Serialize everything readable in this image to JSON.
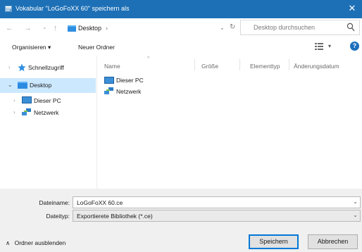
{
  "window": {
    "title": "Vokabular \"LoGoFoXX 60\" speichern als",
    "close_glyph": "✕"
  },
  "navigation": {
    "back_glyph": "←",
    "forward_glyph": "→",
    "history_glyph": "⌄",
    "up_glyph": "↑",
    "address_path": "Desktop",
    "address_chevron": "›",
    "address_dropdown": "⌄",
    "refresh_glyph": "↻",
    "search_placeholder": "Desktop durchsuchen",
    "search_icon": "search-icon"
  },
  "toolbar": {
    "organize_label": "Organisieren ▾",
    "new_folder_label": "Neuer Ordner",
    "view_icon": "view-options-icon",
    "view_dropdown": "▾",
    "help_glyph": "?"
  },
  "nav_pane": {
    "items": [
      {
        "label": "Schnellzugriff",
        "icon": "star-icon",
        "arrow": "›",
        "selected": false
      },
      {
        "label": "Desktop",
        "icon": "desktop-folder-icon",
        "arrow": "⌄",
        "selected": true
      },
      {
        "label": "Dieser PC",
        "icon": "computer-icon",
        "arrow": "›",
        "selected": false
      },
      {
        "label": "Netzwerk",
        "icon": "network-icon",
        "arrow": "›",
        "selected": false
      }
    ]
  },
  "file_list": {
    "columns": [
      "Name",
      "Größe",
      "Elementtyp",
      "Änderungsdatum"
    ],
    "sort_glyph": "^",
    "items": [
      {
        "name": "Dieser PC",
        "icon": "computer-icon"
      },
      {
        "name": "Netzwerk",
        "icon": "network-icon"
      }
    ]
  },
  "save_form": {
    "filename_label": "Dateiname:",
    "filename_value": "LoGoFoXX 60.ce",
    "filetype_label": "Dateityp:",
    "filetype_value": "Exportierete Bibliothek (*.ce)",
    "dropdown_glyph": "⌄"
  },
  "footer": {
    "hide_folders_label": "Ordner ausblenden",
    "hide_folders_glyph": "∧",
    "save_button": "Speichern",
    "cancel_button": "Abbrechen"
  },
  "colors": {
    "titlebar": "#1d70b6",
    "selection": "#cce8ff",
    "accent": "#0078d7",
    "folder_blue": "#2b8be0"
  }
}
